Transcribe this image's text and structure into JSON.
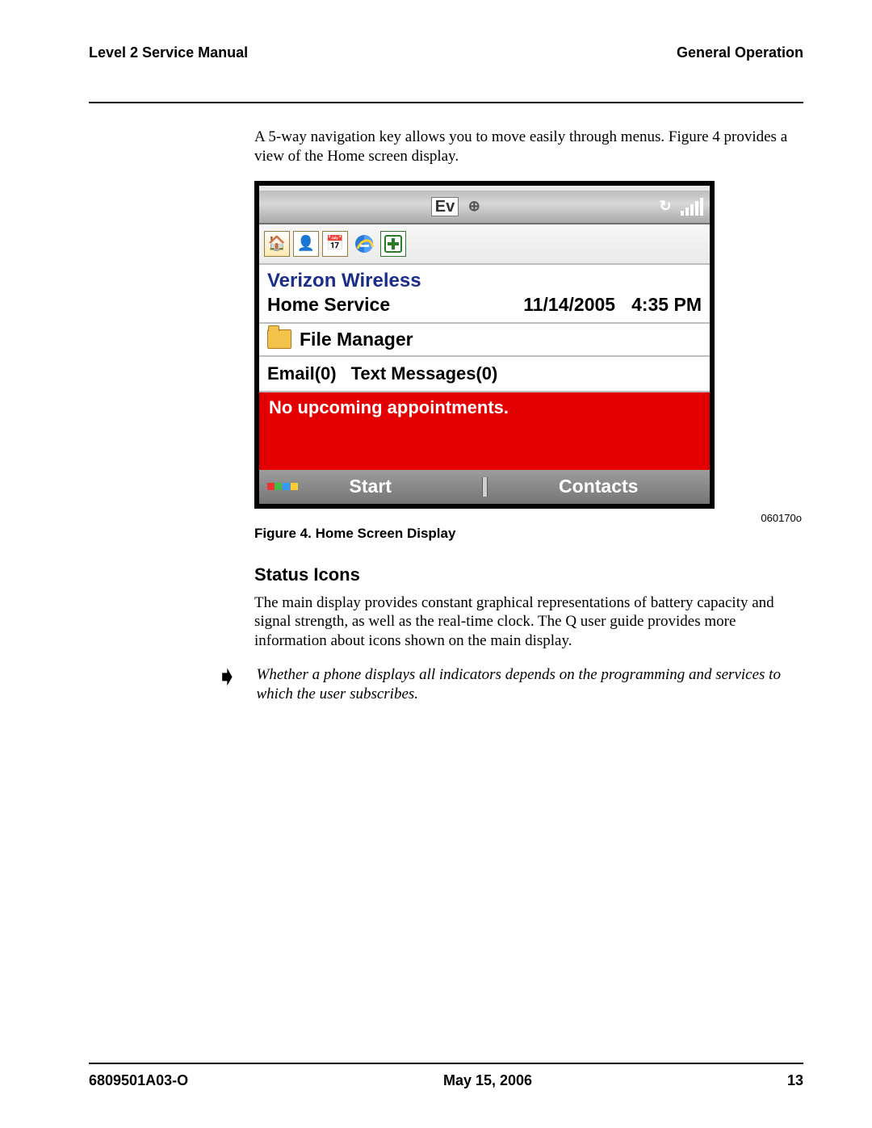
{
  "header": {
    "left": "Level 2 Service Manual",
    "right": "General Operation"
  },
  "body": {
    "intro": "A 5-way navigation key allows you to move easily through menus. Figure 4 provides a view of the Home screen display.",
    "status_para": "The main display provides constant graphical representations of battery capacity and signal strength, as well as the real-time clock. The Q user guide provides more information about icons shown on the main display.",
    "note": "Whether a phone displays all indicators depends on the programming and services to which the user subscribes."
  },
  "figure": {
    "id": "060170o",
    "caption": "Figure 4. Home Screen Display"
  },
  "section": {
    "title": "Status Icons"
  },
  "screen": {
    "status": {
      "ev": "Ev"
    },
    "carrier": "Verizon Wireless",
    "service": "Home Service",
    "date": "11/14/2005",
    "time": "4:35 PM",
    "file_manager": "File Manager",
    "email": "Email(0)",
    "text_msgs": "Text Messages(0)",
    "appointments": "No upcoming appointments.",
    "softkeys": {
      "left": "Start",
      "right": "Contacts"
    }
  },
  "footer": {
    "left": "6809501A03-O",
    "center": "May 15, 2006",
    "right": "13"
  }
}
